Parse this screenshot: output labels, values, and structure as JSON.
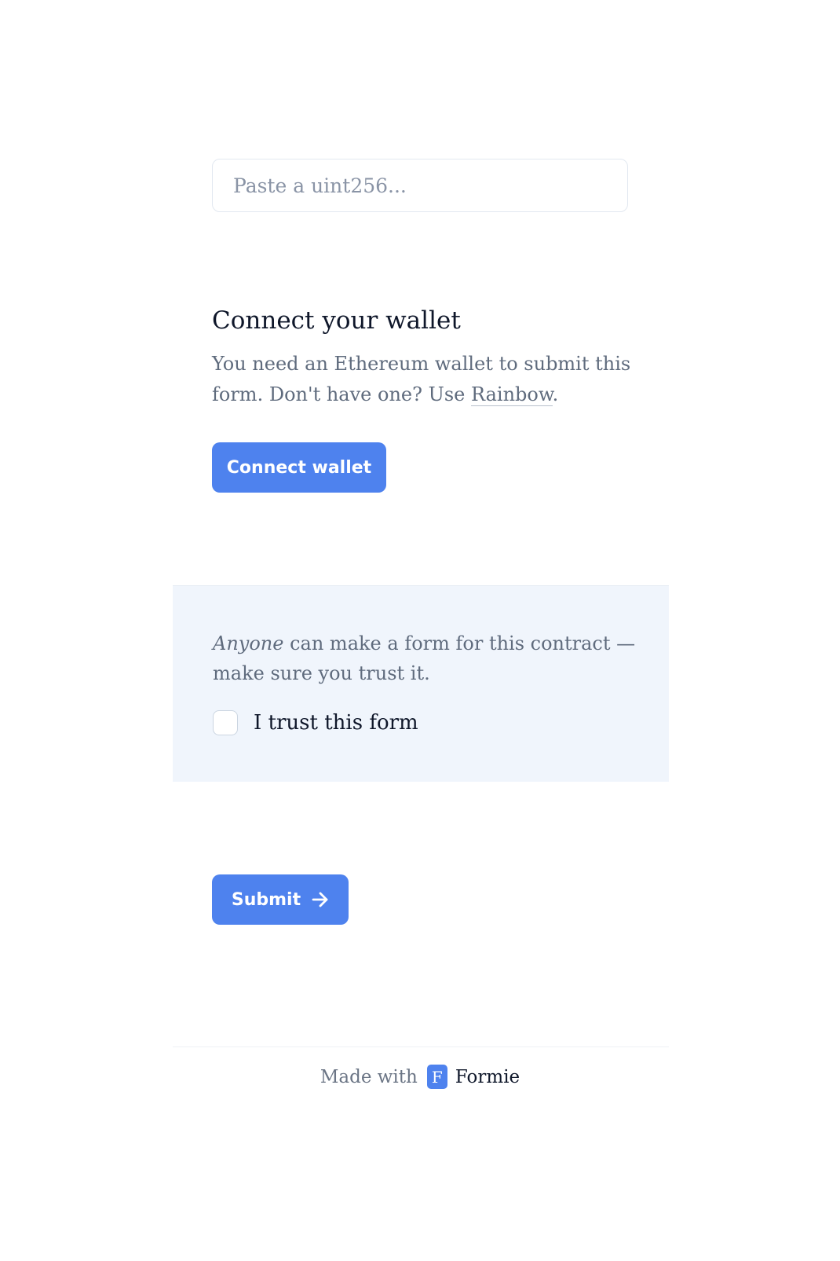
{
  "form": {
    "uint_input": {
      "placeholder": "Paste a uint256...",
      "value": ""
    }
  },
  "wallet": {
    "title": "Connect your wallet",
    "description_prefix": "You need an Ethereum wallet to submit this form. Don't have one? Use ",
    "rainbow_link": "Rainbow",
    "description_suffix": ".",
    "connect_button": "Connect wallet"
  },
  "trust": {
    "emphasis": "Anyone",
    "note_rest": " can make a form for this contract — make sure you trust it.",
    "checkbox_label": "I trust this form",
    "checked": false
  },
  "submit": {
    "label": "Submit",
    "icon": "arrow-right-icon"
  },
  "footer": {
    "made_with": "Made with",
    "brand_letter": "F",
    "brand_name": "Formie"
  },
  "colors": {
    "accent": "#4e82ee",
    "panel_bg": "#f0f5fc",
    "muted_text": "#5f6b7d",
    "heading_text": "#0f172a"
  }
}
